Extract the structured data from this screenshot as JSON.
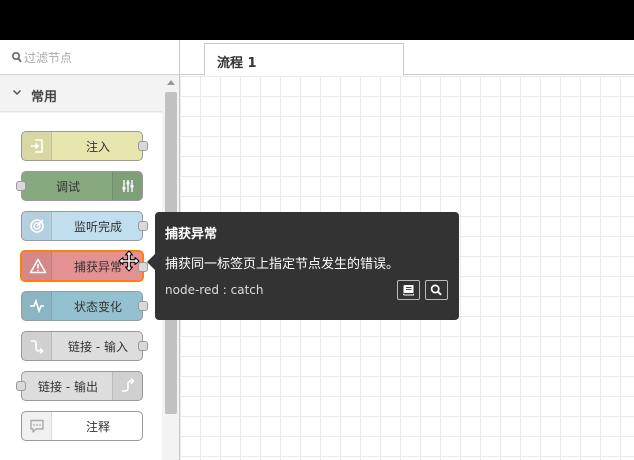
{
  "palette": {
    "filter_placeholder": "过滤节点",
    "category": "常用",
    "nodes": [
      {
        "label": "注入",
        "color": "#e7e6af",
        "icon": "inject-icon",
        "icon_side": "left",
        "port": "out"
      },
      {
        "label": "调试",
        "color": "#87a980",
        "icon": "debug-icon",
        "icon_side": "right",
        "port": "in"
      },
      {
        "label": "监听完成",
        "color": "#c0deed",
        "icon": "complete-icon",
        "icon_side": "left",
        "port": "out"
      },
      {
        "label": "捕获异常",
        "color": "#e49191",
        "icon": "catch-icon",
        "icon_side": "left",
        "port": "out"
      },
      {
        "label": "状态变化",
        "color": "#94c1d0",
        "icon": "status-icon",
        "icon_side": "left",
        "port": "out"
      },
      {
        "label": "链接 - 输入",
        "color": "#ddd",
        "icon": "link-in-icon",
        "icon_side": "left",
        "port": "out"
      },
      {
        "label": "链接 - 输出",
        "color": "#ddd",
        "icon": "link-out-icon",
        "icon_side": "right",
        "port": "in"
      },
      {
        "label": "注释",
        "color": "#fff",
        "icon": "comment-icon",
        "icon_side": "left",
        "port": "none"
      }
    ]
  },
  "workspace": {
    "tab_label": "流程 1"
  },
  "tooltip": {
    "title": "捕获异常",
    "description": "捕获同一标签页上指定节点发生的错误。",
    "type": "node-red : catch"
  }
}
